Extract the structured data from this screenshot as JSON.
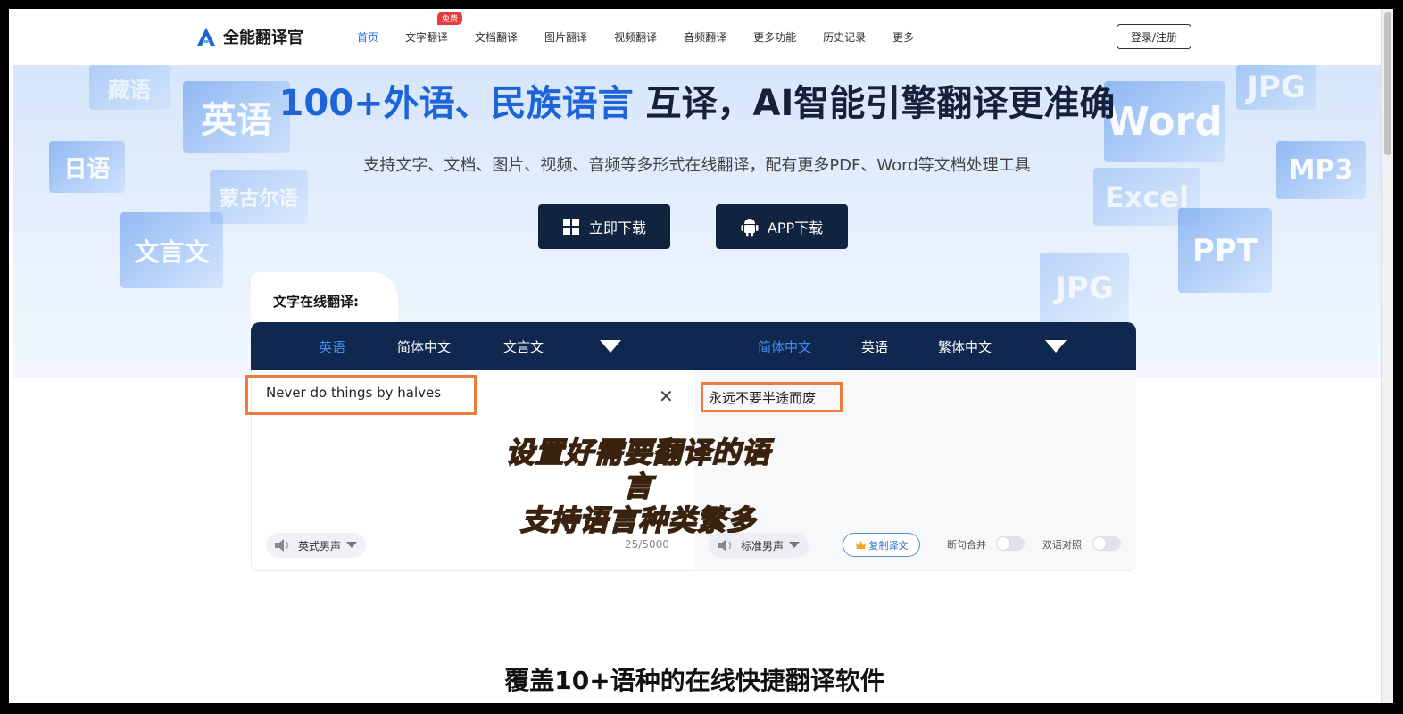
{
  "header": {
    "logo_text": "全能翻译官",
    "nav": [
      {
        "label": "首页",
        "active": true
      },
      {
        "label": "文字翻译",
        "badge": "免费"
      },
      {
        "label": "文档翻译"
      },
      {
        "label": "图片翻译"
      },
      {
        "label": "视频翻译"
      },
      {
        "label": "音频翻译"
      },
      {
        "label": "更多功能"
      },
      {
        "label": "历史记录"
      },
      {
        "label": "更多"
      }
    ],
    "login_label": "登录/注册"
  },
  "hero": {
    "title_blue": "100+外语、民族语言",
    "title_dark": "互译，AI智能引擎翻译更准确",
    "subtitle": "支持文字、文档、图片、视频、音频等多形式在线翻译，配有更多PDF、Word等文档处理工具",
    "download_btn": "立即下载",
    "app_btn": "APP下载",
    "left_tiles": [
      "藏语",
      "英语",
      "日语",
      "蒙古尔语",
      "文言文"
    ],
    "right_tiles": [
      "JPG",
      "Word",
      "MP3",
      "Excel",
      "PPT",
      "JPG"
    ]
  },
  "translator": {
    "tab_label": "文字在线翻译:",
    "source_langs": [
      {
        "label": "英语",
        "active": true
      },
      {
        "label": "简体中文"
      },
      {
        "label": "文言文"
      }
    ],
    "target_langs": [
      {
        "label": "简体中文",
        "active": true
      },
      {
        "label": "英语"
      },
      {
        "label": "繁体中文"
      }
    ],
    "source_text": "Never do things by halves",
    "target_text": "永远不要半途而废",
    "overlay_line1": "设置好需要翻译的语言",
    "overlay_line2": "支持语言种类繁多",
    "source_voice": "英式男声",
    "target_voice": "标准男声",
    "char_count": "25/5000",
    "copy_label": "复制译文",
    "toggle1_label": "断句合并",
    "toggle2_label": "双语对照"
  },
  "section_title": "覆盖10+语种的在线快捷翻译软件",
  "colors": {
    "accent_blue": "#1c64d8",
    "navy": "#10284f",
    "highlight_orange": "#ef7b3c"
  }
}
